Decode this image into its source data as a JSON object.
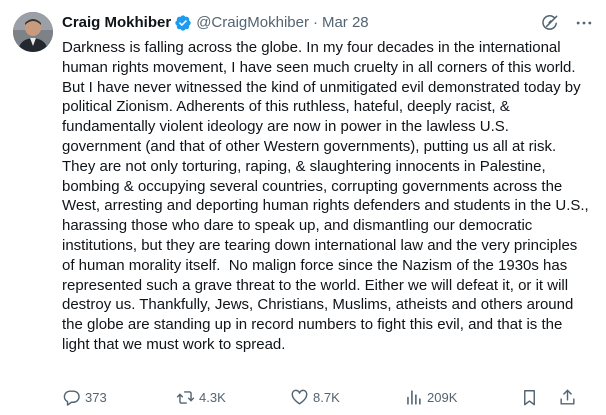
{
  "author": {
    "name": "Craig Mokhiber",
    "handle": "@CraigMokhiber",
    "separator": "·",
    "date": "Mar 28",
    "verified": true
  },
  "tweet": {
    "text": "Darkness is falling across the globe. In my four decades in the international human rights movement, I have seen much cruelty in all corners of this world. But I have never witnessed the kind of unmitigated evil demonstrated today by political Zionism. Adherents of this ruthless, hateful, deeply racist, & fundamentally violent ideology are now in power in the lawless U.S. government (and that of other Western governments), putting us all at risk. They are not only torturing, raping, & slaughtering innocents in Palestine,  bombing & occupying several countries, corrupting governments across the West, arresting and deporting human rights defenders and students in the U.S.,  harassing those who dare to speak up, and dismantling our democratic institutions, but they are tearing down international law and the very principles of human morality itself.  No malign force since the Nazism of the 1930s has represented such a grave threat to the world. Either we will defeat it, or it will destroy us. Thankfully, Jews, Christians, Muslims, atheists and others around the globe are standing up in record numbers to fight this evil, and that is the light that we must work to spread."
  },
  "actions": {
    "replies": "373",
    "reposts": "4.3K",
    "likes": "8.7K",
    "views": "209K"
  },
  "icons": {
    "verified": "verified-badge-icon",
    "grok": "grok-icon",
    "more": "more-icon",
    "reply": "reply-icon",
    "repost": "repost-icon",
    "like": "like-icon",
    "views": "views-icon",
    "bookmark": "bookmark-icon",
    "share": "share-icon"
  },
  "colors": {
    "text": "#0f1419",
    "secondary": "#536471",
    "verified": "#1d9bf0",
    "background": "#ffffff"
  }
}
